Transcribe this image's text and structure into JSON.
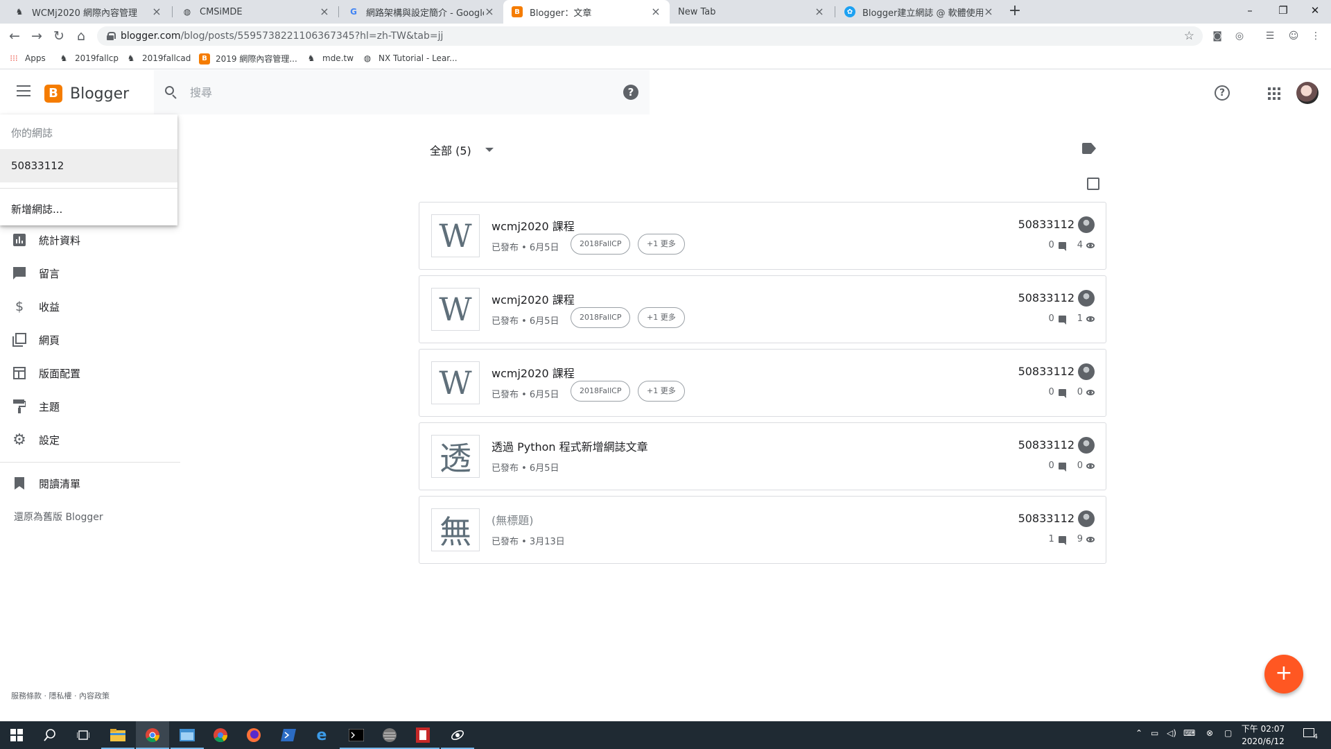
{
  "browser": {
    "tabs": [
      {
        "title": "WCMj2020 網際內容管理",
        "active": false
      },
      {
        "title": "CMSiMDE",
        "active": false
      },
      {
        "title": "網路架構與設定簡介 - Google 搜",
        "active": false
      },
      {
        "title": "Blogger：文章",
        "active": true
      },
      {
        "title": "New Tab",
        "active": false
      },
      {
        "title": "Blogger建立網誌 @ 軟體使用教",
        "active": false
      }
    ],
    "new_tab": "+",
    "window_controls": {
      "minimize": "–",
      "maximize": "❐",
      "close": "✕"
    },
    "url_host": "blogger.com",
    "url_path": "/blog/posts/5595738221106367345?hl=zh-TW&tab=jj",
    "bookmarks": [
      {
        "label": "Apps"
      },
      {
        "label": "2019fallcp"
      },
      {
        "label": "2019fallcad"
      },
      {
        "label": "2019 網際內容管理..."
      },
      {
        "label": "mde.tw"
      },
      {
        "label": "NX Tutorial - Lear..."
      }
    ]
  },
  "header": {
    "brand": "Blogger",
    "logo_letter": "B",
    "search_placeholder": "搜尋",
    "search_help": "?",
    "help": "?"
  },
  "dropdown": {
    "header": "你的網誌",
    "blog": "50833112",
    "new_blog": "新增網誌..."
  },
  "sidebar": {
    "items": [
      {
        "label": "統計資料",
        "icon": "bar-chart-icon"
      },
      {
        "label": "留言",
        "icon": "comment-icon"
      },
      {
        "label": "收益",
        "icon": "dollar-icon"
      },
      {
        "label": "網頁",
        "icon": "pages-icon"
      },
      {
        "label": "版面配置",
        "icon": "layout-icon"
      },
      {
        "label": "主題",
        "icon": "paint-roller-icon"
      },
      {
        "label": "設定",
        "icon": "gear-icon"
      }
    ],
    "reading_list": "閱讀清單",
    "legacy": "還原為舊版 Blogger",
    "footer": "服務條款 · 隱私權 · 內容政策"
  },
  "posts_view": {
    "filter": "全部 (5)"
  },
  "posts": [
    {
      "thumb": "W",
      "title": "wcmj2020 課程",
      "status": "已發布 • 6月5日",
      "labels": [
        "2018FallCP",
        "+1 更多"
      ],
      "author": "50833112",
      "comments": "0",
      "views": "4"
    },
    {
      "thumb": "W",
      "title": "wcmj2020 課程",
      "status": "已發布 • 6月5日",
      "labels": [
        "2018FallCP",
        "+1 更多"
      ],
      "author": "50833112",
      "comments": "0",
      "views": "1"
    },
    {
      "thumb": "W",
      "title": "wcmj2020 課程",
      "status": "已發布 • 6月5日",
      "labels": [
        "2018FallCP",
        "+1 更多"
      ],
      "author": "50833112",
      "comments": "0",
      "views": "0"
    },
    {
      "thumb": "透",
      "title": "透過 Python 程式新增網誌文章",
      "status": "已發布 • 6月5日",
      "labels": [],
      "author": "50833112",
      "comments": "0",
      "views": "0"
    },
    {
      "thumb": "無",
      "title": "(無標題)",
      "status": "已發布 • 3月13日",
      "labels": [],
      "author": "50833112",
      "comments": "1",
      "views": "9"
    }
  ],
  "fab": "+",
  "taskbar": {
    "clock_time": "下午 02:07",
    "clock_date": "2020/6/12",
    "notification_count": "4"
  },
  "colors": {
    "blogger_orange": "#f57c00",
    "fab": "#ff5722",
    "taskbar": "#1f2a33"
  }
}
